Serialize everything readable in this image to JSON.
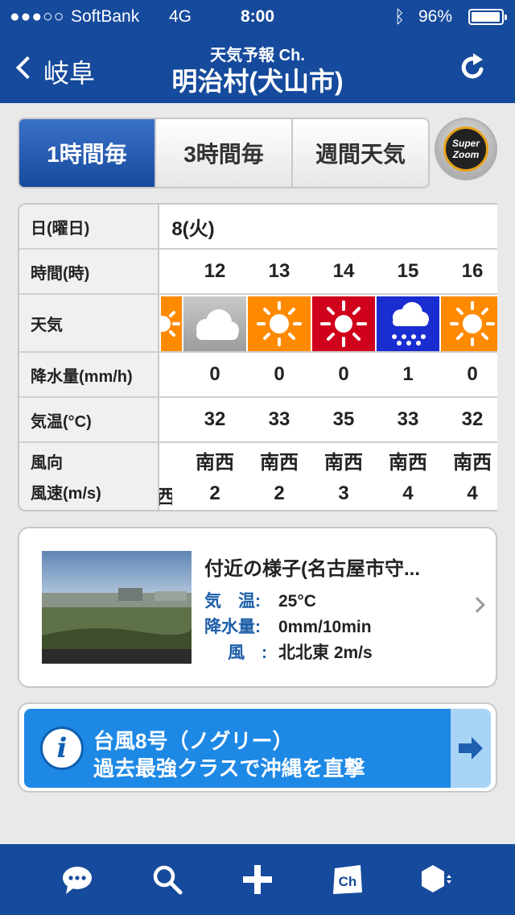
{
  "status": {
    "signal": "●●●○○",
    "carrier": "SoftBank",
    "network": "4G",
    "time": "8:00",
    "battery": "96%"
  },
  "nav": {
    "back_label": "岐阜",
    "subtitle": "天気予報 Ch.",
    "title": "明治村(犬山市)"
  },
  "tabs": [
    "1時間毎",
    "3時間毎",
    "週間天気"
  ],
  "superzoom": {
    "line1": "Super",
    "line2": "Zoom"
  },
  "table": {
    "labels": {
      "date": "日(曜日)",
      "hour": "時間(時)",
      "weather": "天気",
      "precip": "降水量(mm/h)",
      "temp": "気温(°C)",
      "wind_dir": "風向",
      "wind_speed": "風速(m/s)"
    },
    "date": "8(火)",
    "hours": [
      "12",
      "13",
      "14",
      "15",
      "16"
    ],
    "weather": [
      "sun-icon",
      "cloud-icon",
      "sun-icon",
      "hot-sun-icon",
      "rain-icon",
      "sun-icon"
    ],
    "precip": [
      "0",
      "0",
      "0",
      "1",
      "0"
    ],
    "temp": [
      "32",
      "33",
      "35",
      "33",
      "32"
    ],
    "wind_dir_partial": "西",
    "wind_dir": [
      "南西",
      "南西",
      "南西",
      "南西",
      "南西"
    ],
    "wind_speed": [
      "2",
      "2",
      "3",
      "4",
      "4"
    ]
  },
  "nearby": {
    "title": "付近の様子(名古屋市守...",
    "temp_label": "気　温:",
    "temp_value": "25°C",
    "precip_label": "降水量:",
    "precip_value": "0mm/10min",
    "wind_label": "風　:",
    "wind_value": "北北東 2m/s"
  },
  "news": {
    "line1": "台風8号（ノグリー）",
    "line2": "過去最強クラスで沖縄を直撃"
  },
  "toolbar": [
    "chat-icon",
    "search-icon",
    "add-icon",
    "channel-icon",
    "hexagon-menu-icon"
  ],
  "colors": {
    "brand": "#164a9c",
    "sun": "#ff8a00",
    "hot": "#d0021b",
    "rain": "#1a2dd0",
    "news": "#1e88e5"
  }
}
